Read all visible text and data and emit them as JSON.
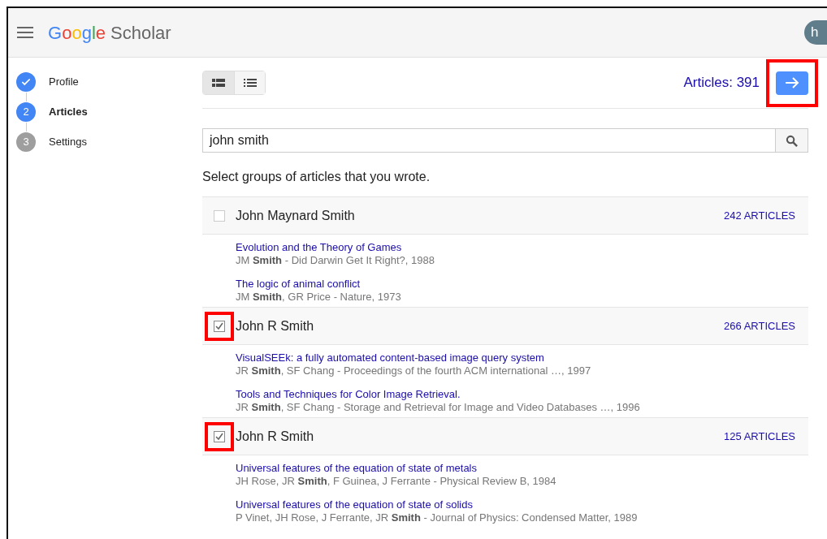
{
  "header": {
    "logo": {
      "brand": "Google",
      "product": "Scholar"
    },
    "avatar": "h"
  },
  "steps": [
    {
      "label": "Profile",
      "completed": true,
      "selected": false
    },
    {
      "label": "Articles",
      "number": "2",
      "completed": false,
      "selected": true
    },
    {
      "label": "Settings",
      "number": "3",
      "completed": false,
      "selected": false
    }
  ],
  "view_toggle": [
    {
      "kind": "detailed",
      "selected": true
    },
    {
      "kind": "compact",
      "selected": false
    }
  ],
  "article_count": "Articles: 391",
  "next_button": {
    "annotated": true
  },
  "search": {
    "value": "john smith"
  },
  "instruction": "Select groups of articles that you wrote.",
  "groups": [
    {
      "name": "John Maynard Smith",
      "count": "242 ARTICLES",
      "checked": false,
      "annotated": false,
      "articles": [
        {
          "title": "Evolution and the Theory of Games",
          "meta": "JM **Smith** - Did Darwin Get It Right?, 1988"
        },
        {
          "title": "The logic of animal conflict",
          "meta": "JM **Smith**, GR Price - Nature, 1973"
        }
      ]
    },
    {
      "name": "John R Smith",
      "count": "266 ARTICLES",
      "checked": true,
      "annotated": true,
      "articles": [
        {
          "title": "VisualSEEk: a fully automated content-based image query system",
          "meta": "JR **Smith**, SF Chang - Proceedings of the fourth ACM international …, 1997"
        },
        {
          "title": "Tools and Techniques for Color Image Retrieval.",
          "meta": "JR **Smith**, SF Chang - Storage and Retrieval for Image and Video Databases …, 1996"
        }
      ]
    },
    {
      "name": "John R Smith",
      "count": "125 ARTICLES",
      "checked": true,
      "annotated": true,
      "articles": [
        {
          "title": "Universal features of the equation of state of metals",
          "meta": "JH Rose, JR **Smith**, F Guinea, J Ferrante - Physical Review B, 1984"
        },
        {
          "title": "Universal features of the equation of state of solids",
          "meta": "P Vinet, JH Rose, J Ferrante, JR **Smith** - Journal of Physics: Condensed Matter, 1989"
        }
      ]
    }
  ]
}
